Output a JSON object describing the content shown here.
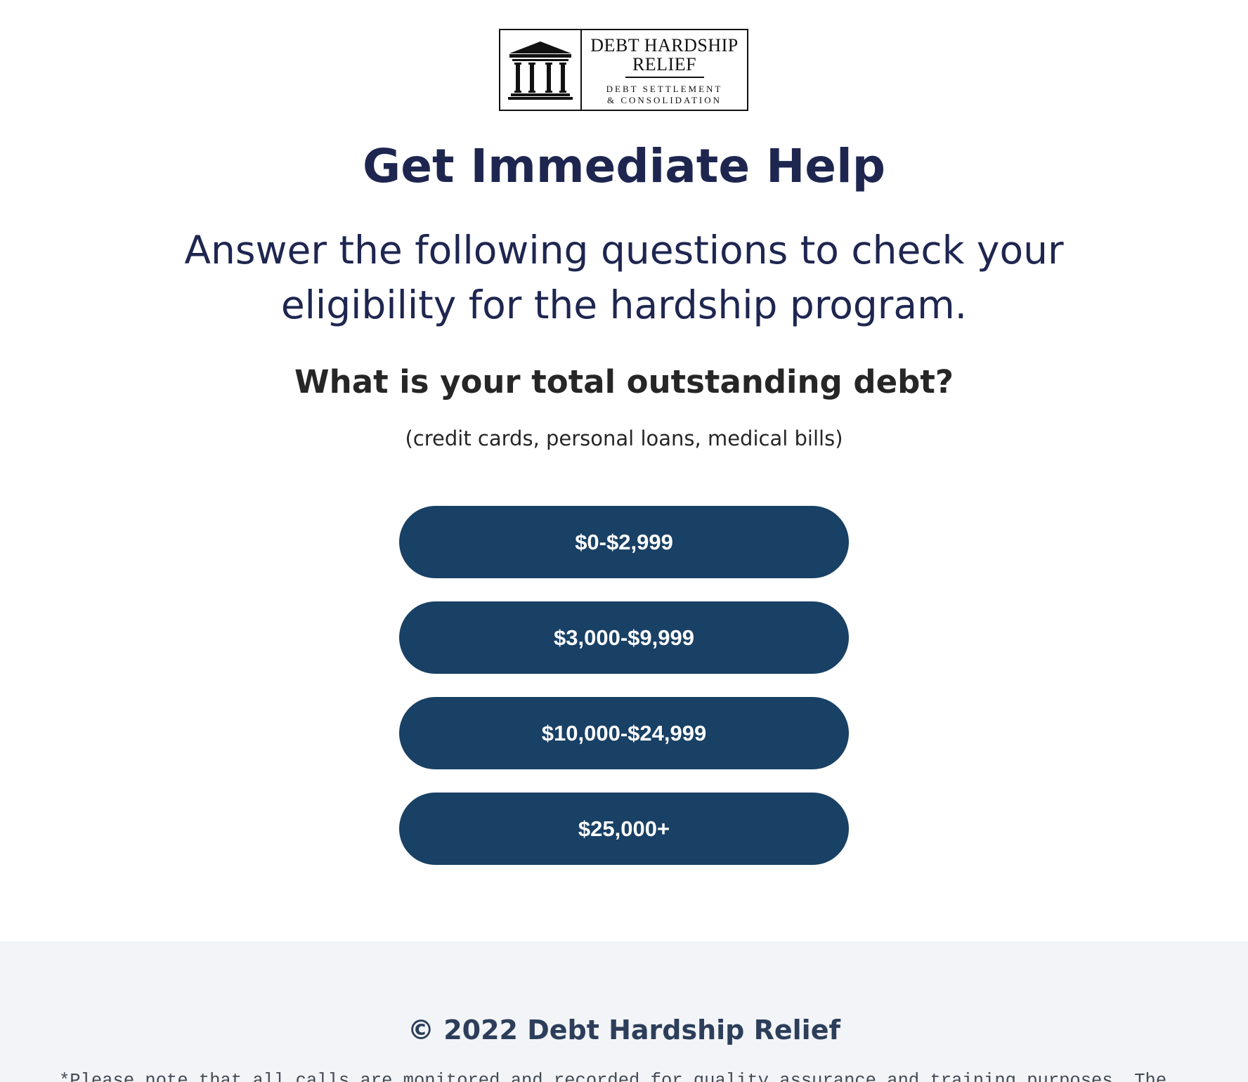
{
  "logo": {
    "name_line1": "DEBT HARDSHIP",
    "name_line2": "RELIEF",
    "sub_line1": "DEBT SETTLEMENT",
    "sub_line2": "& CONSOLIDATION",
    "icon": "courthouse-icon"
  },
  "hero": {
    "title": "Get Immediate Help",
    "subtitle": "Answer the following questions to check your eligibility for the hardship program."
  },
  "question": {
    "text": "What is your total outstanding debt?",
    "hint": "(credit cards, personal loans, medical bills)",
    "options": [
      {
        "label": "$0-$2,999"
      },
      {
        "label": "$3,000-$9,999"
      },
      {
        "label": "$10,000-$24,999"
      },
      {
        "label": "$25,000+"
      }
    ]
  },
  "footer": {
    "copyright": "© 2022 Debt Hardship Relief",
    "disclaimer": "*Please note that all calls are monitored and recorded for quality assurance and training purposes. The"
  },
  "colors": {
    "heading": "#1e2650",
    "button_bg": "#194065",
    "button_text": "#ffffff",
    "footer_bg": "#f2f4f7"
  }
}
